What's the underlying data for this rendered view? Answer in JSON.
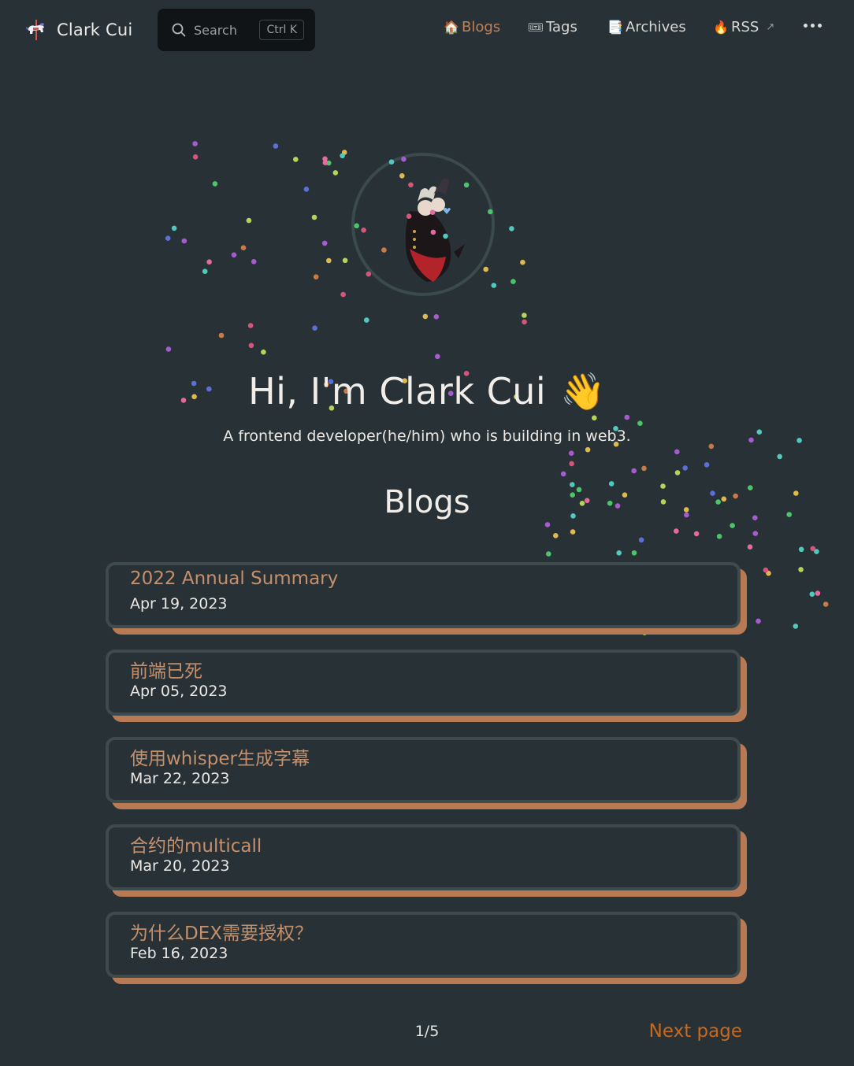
{
  "brand": {
    "name": "Clark Cui",
    "logo_icon": "carousel-horse-icon"
  },
  "search": {
    "label": "Search",
    "shortcut": "Ctrl K"
  },
  "nav": {
    "items": [
      {
        "emoji": "🏠",
        "label": "Blogs",
        "active": true
      },
      {
        "emoji": "🎟",
        "label": "Tags",
        "active": false
      },
      {
        "emoji": "📑",
        "label": "Archives",
        "active": false
      },
      {
        "emoji": "🔥",
        "label": "RSS",
        "external": true,
        "active": false
      }
    ],
    "more_icon": "more-horizontal-icon"
  },
  "hero": {
    "title": "Hi, I'm Clark Cui",
    "wave_emoji": "👋",
    "subtitle": "A frontend developer(he/him) who is building in web3."
  },
  "section": {
    "title": "Blogs"
  },
  "posts": [
    {
      "title": "2022 Annual Summary",
      "date": "Apr 19, 2023"
    },
    {
      "title": "前端已死",
      "date": "Apr 05, 2023"
    },
    {
      "title": "使用whisper生成字幕",
      "date": "Mar 22, 2023"
    },
    {
      "title": "合约的multicall",
      "date": "Mar 20, 2023"
    },
    {
      "title": "为什么DEX需要授权？",
      "date": "Feb 16, 2023"
    }
  ],
  "pagination": {
    "current": "1/5",
    "next_label": "Next page"
  },
  "colors": {
    "background": "#283236",
    "accent": "#c07f57",
    "card_shadow": "#b87a55",
    "next_link": "#c8681e"
  }
}
